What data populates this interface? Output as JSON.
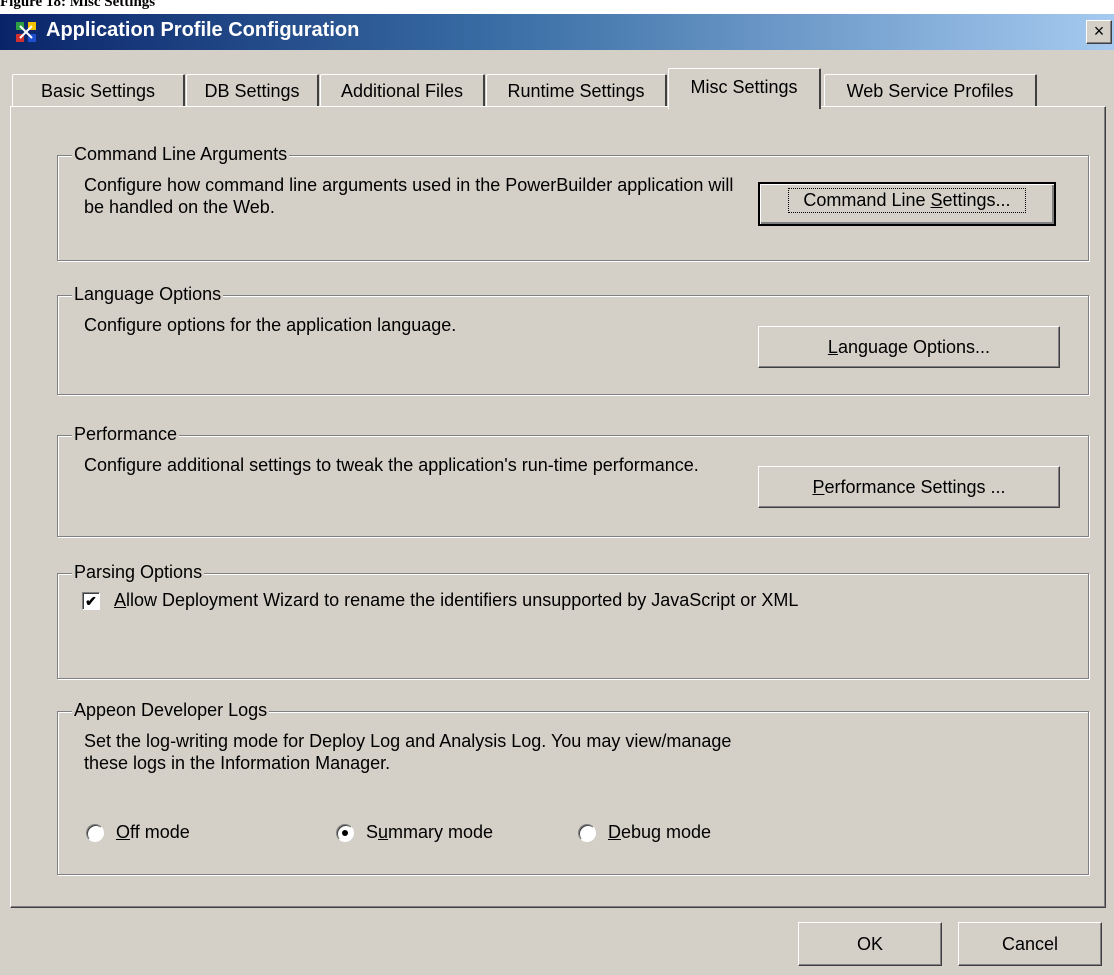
{
  "caption": "Figure 18: Misc Settings",
  "window": {
    "title": "Application Profile Configuration",
    "close_glyph": "×",
    "icon": "app-profile-icon"
  },
  "tabs": [
    {
      "label": "Basic Settings",
      "active": false
    },
    {
      "label": "DB Settings",
      "active": false
    },
    {
      "label": "Additional Files",
      "active": false
    },
    {
      "label": "Runtime Settings",
      "active": false
    },
    {
      "label": "Misc Settings",
      "active": true
    },
    {
      "label": "Web Service Profiles",
      "active": false
    }
  ],
  "groups": {
    "command_line": {
      "title": "Command Line Arguments",
      "description": "Configure how command line arguments used in the PowerBuilder application will be handled on the Web.",
      "button": {
        "pre": "Command Line ",
        "mn": "S",
        "post": "ettings..."
      }
    },
    "language": {
      "title": "Language Options",
      "description": "Configure options for the application language.",
      "button": {
        "pre": "",
        "mn": "L",
        "post": "anguage Options..."
      }
    },
    "performance": {
      "title": "Performance",
      "description": "Configure additional settings to tweak the application's run-time performance.",
      "button": {
        "pre": "",
        "mn": "P",
        "post": "erformance Settings ..."
      }
    },
    "parsing": {
      "title": "Parsing Options",
      "checkbox": {
        "checked": true,
        "glyph": "✔",
        "pre": "",
        "mn": "A",
        "post": "llow Deployment Wizard to rename the identifiers unsupported by JavaScript or XML"
      }
    },
    "logs": {
      "title": "Appeon Developer Logs",
      "description": "Set the log-writing mode for Deploy Log and Analysis Log.  You may view/manage these logs in the Information Manager.",
      "options": [
        {
          "pre": "",
          "mn": "O",
          "post": "ff mode",
          "selected": false
        },
        {
          "pre": "S",
          "mn": "u",
          "post": "mmary mode",
          "selected": true
        },
        {
          "pre": "",
          "mn": "D",
          "post": "ebug mode",
          "selected": false
        }
      ]
    }
  },
  "footer": {
    "ok_label": "OK",
    "cancel_label": "Cancel"
  }
}
